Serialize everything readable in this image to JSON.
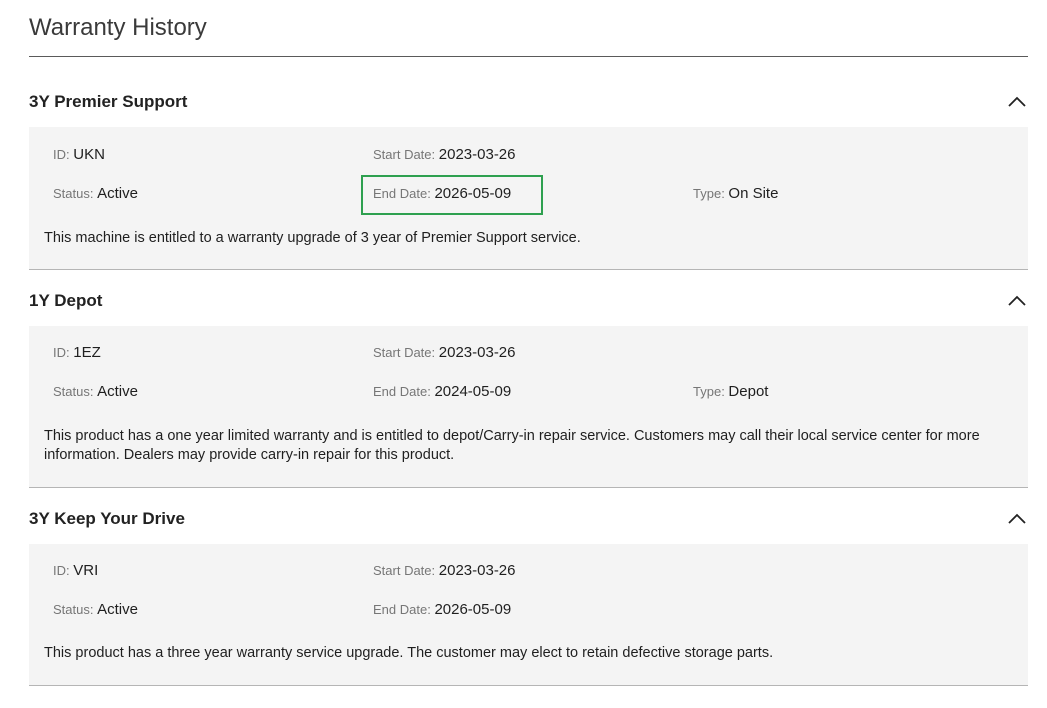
{
  "page": {
    "title": "Warranty History",
    "highlight_color": "#2ea04f"
  },
  "sections": [
    {
      "title": "3Y Premier Support",
      "expanded": true,
      "id_label": "ID",
      "id_value": "UKN",
      "start_label": "Start Date",
      "start_value": "2023-03-26",
      "status_label": "Status",
      "status_value": "Active",
      "end_label": "End Date",
      "end_value": "2026-05-09",
      "type_label": "Type",
      "type_value": "On Site",
      "description": "This machine is entitled to a warranty upgrade of 3 year of Premier Support service."
    },
    {
      "title": "1Y Depot",
      "expanded": true,
      "id_label": "ID",
      "id_value": "1EZ",
      "start_label": "Start Date",
      "start_value": "2023-03-26",
      "status_label": "Status",
      "status_value": "Active",
      "end_label": "End Date",
      "end_value": "2024-05-09",
      "type_label": "Type",
      "type_value": "Depot",
      "description": "This product has a one year limited warranty and is entitled to depot/Carry-in repair service. Customers may call their local service center for more information. Dealers may provide carry-in repair for this product."
    },
    {
      "title": "3Y Keep Your Drive",
      "expanded": true,
      "id_label": "ID",
      "id_value": "VRI",
      "start_label": "Start Date",
      "start_value": "2023-03-26",
      "status_label": "Status",
      "status_value": "Active",
      "end_label": "End Date",
      "end_value": "2026-05-09",
      "description": "This product has a three year warranty service upgrade. The customer may elect to retain defective storage parts."
    }
  ],
  "icons": {
    "collapse": "chevron-up-icon"
  }
}
